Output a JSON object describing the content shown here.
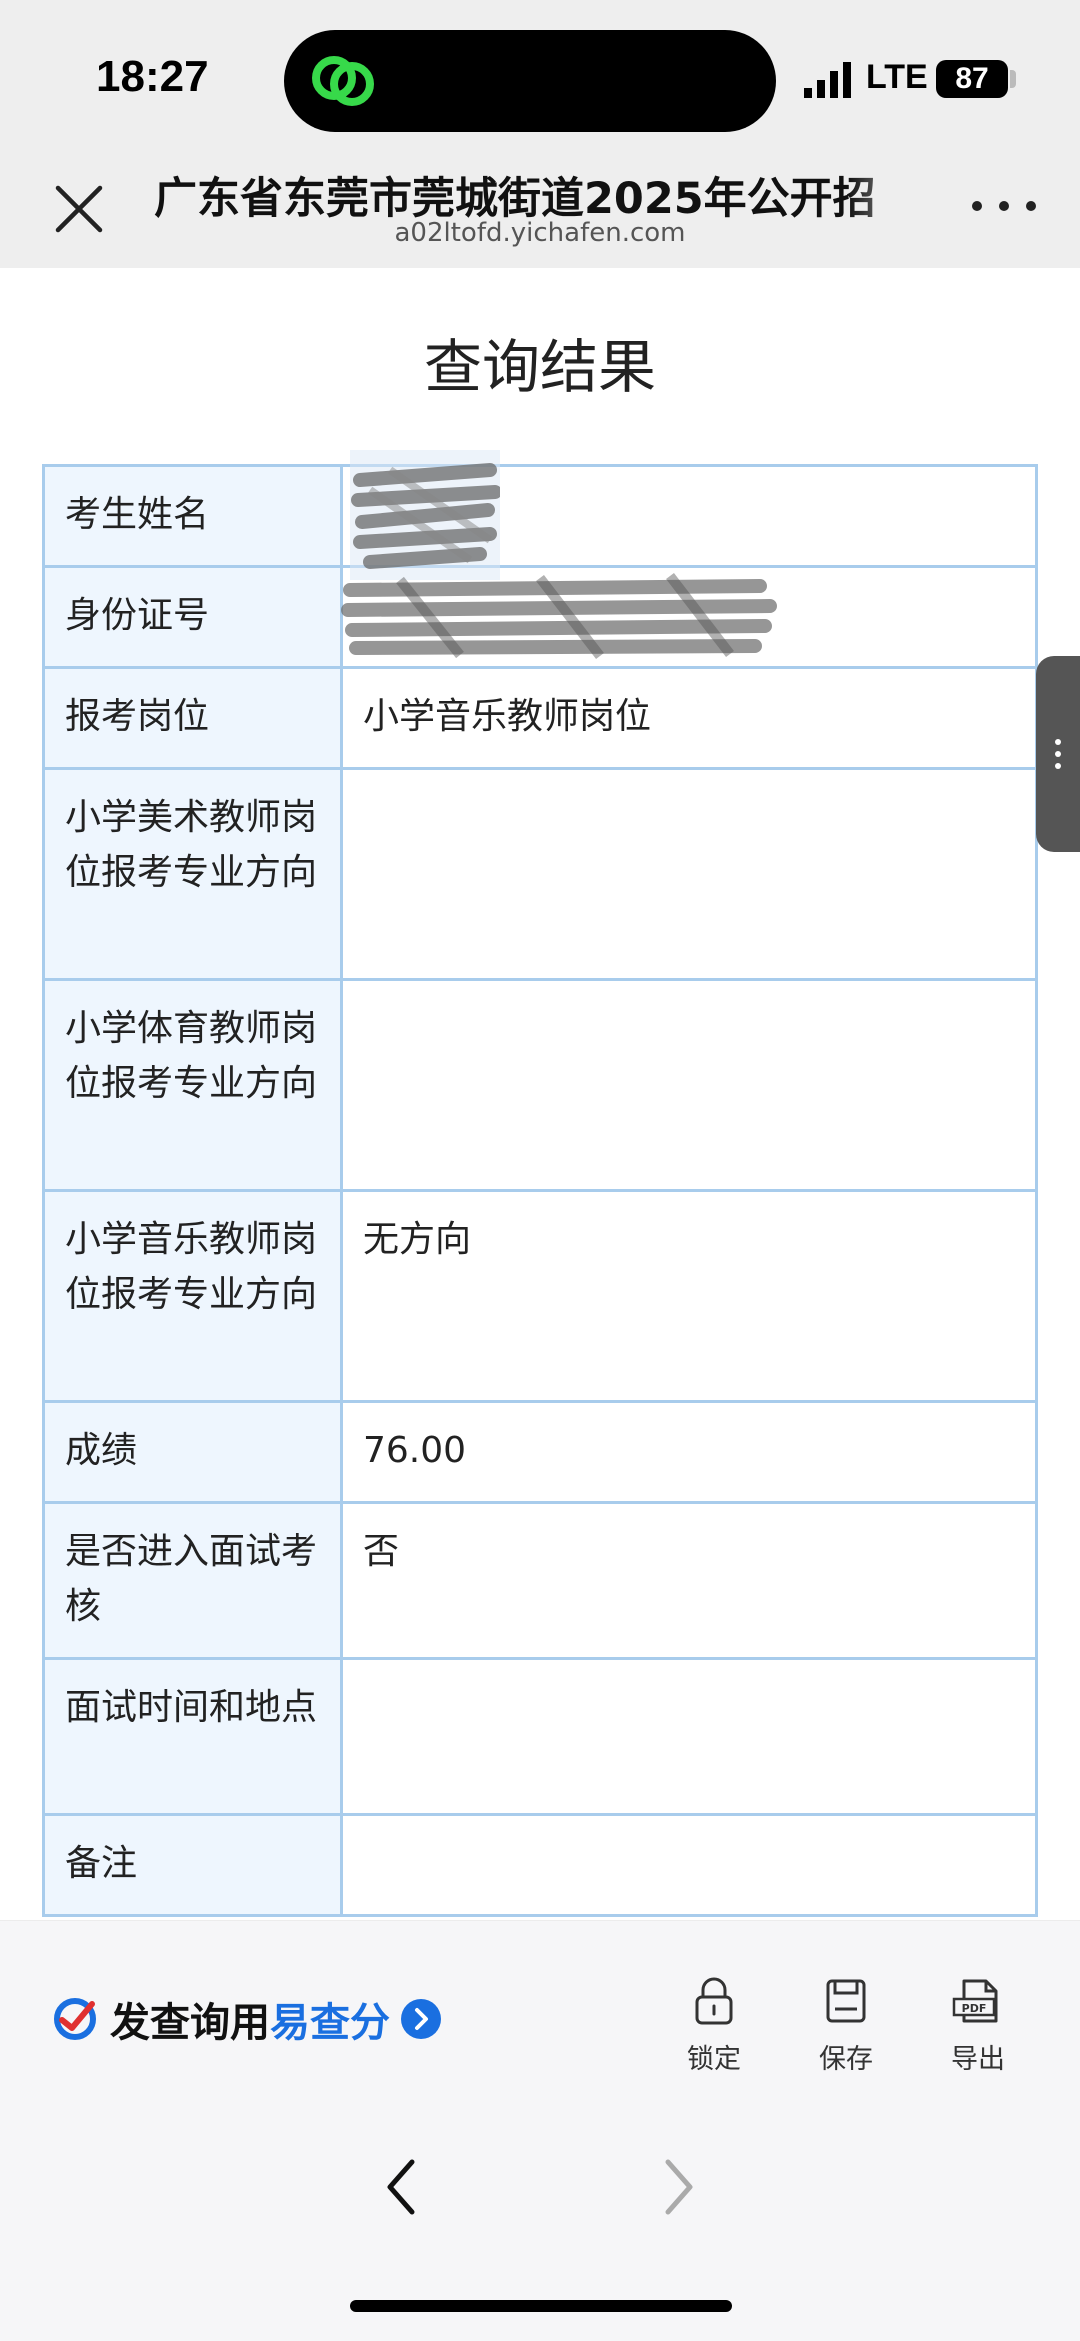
{
  "status_bar": {
    "time": "18:27",
    "network": "LTE",
    "battery": "87"
  },
  "nav": {
    "title": "广东省东莞市莞城街道2025年公开招",
    "url": "a02ltofd.yichafen.com"
  },
  "page": {
    "title": "查询结果"
  },
  "table": {
    "rows": [
      {
        "label": "考生姓名",
        "value": ""
      },
      {
        "label": "身份证号",
        "value": ""
      },
      {
        "label": "报考岗位",
        "value": "小学音乐教师岗位"
      },
      {
        "label": "小学美术教师岗位报考专业方向",
        "value": ""
      },
      {
        "label": "小学体育教师岗位报考专业方向",
        "value": ""
      },
      {
        "label": "小学音乐教师岗位报考专业方向",
        "value": "无方向"
      },
      {
        "label": "成绩",
        "value": "76.00"
      },
      {
        "label": "是否进入面试考核",
        "value": "否"
      },
      {
        "label": "面试时间和地点",
        "value": ""
      },
      {
        "label": "备注",
        "value": ""
      }
    ]
  },
  "toolbar": {
    "brand_text": "发查询用",
    "brand_name": "易查分",
    "lock_label": "锁定",
    "save_label": "保存",
    "export_label": "导出",
    "pdf_icon_text": "PDF"
  },
  "colors": {
    "table_border": "#a8ccec",
    "label_bg": "#eef6fe",
    "brand_blue": "#1a6fe0",
    "header_bg": "#eeeeee"
  },
  "icons": {
    "close": "close-icon",
    "more": "more-icon",
    "lock": "lock-icon",
    "save": "save-icon",
    "export": "pdf-export-icon",
    "back": "chevron-left-icon",
    "forward": "chevron-right-icon"
  }
}
